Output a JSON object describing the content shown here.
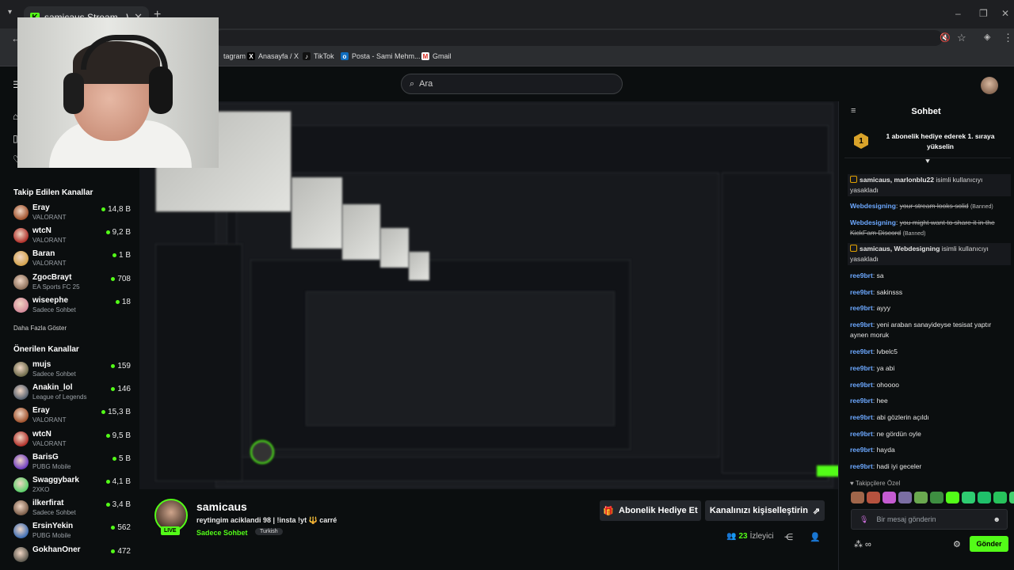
{
  "browser": {
    "tab_title": "samicaus Stream - Watch L",
    "bookmarks": [
      "tagram",
      "Anasayfa / X",
      "TikTok",
      "Posta - Sami Mehm...",
      "Gmail"
    ]
  },
  "kick": {
    "search_placeholder": "Ara"
  },
  "sidebar": {
    "followed_title": "Takip Edilen Kanallar",
    "followed": [
      {
        "name": "Eray",
        "game": "VALORANT",
        "viewers": "14,8 B",
        "color": "#a0522d"
      },
      {
        "name": "wtcN",
        "game": "VALORANT",
        "viewers": "9,2 B",
        "color": "#b0302a"
      },
      {
        "name": "Baran",
        "game": "VALORANT",
        "viewers": "1 B",
        "color": "#d2a24c"
      },
      {
        "name": "ZgocBrayt",
        "game": "EA Sports FC 25",
        "viewers": "708",
        "color": "#8c6f5a"
      },
      {
        "name": "wiseephe",
        "game": "Sadece Sohbet",
        "viewers": "18",
        "color": "#d48a9a"
      }
    ],
    "show_more": "Daha Fazla Göster",
    "recommended_title": "Önerilen Kanallar",
    "recommended": [
      {
        "name": "mujs",
        "game": "Sadece Sohbet",
        "viewers": "159",
        "color": "#6d6a4a"
      },
      {
        "name": "Anakin_lol",
        "game": "League of Legends",
        "viewers": "146",
        "color": "#56606e"
      },
      {
        "name": "Eray",
        "game": "VALORANT",
        "viewers": "15,3 B",
        "color": "#a0522d"
      },
      {
        "name": "wtcN",
        "game": "VALORANT",
        "viewers": "9,5 B",
        "color": "#b0302a"
      },
      {
        "name": "BarisG",
        "game": "PUBG Mobile",
        "viewers": "5 B",
        "color": "#6f3dc0"
      },
      {
        "name": "Swaggybark",
        "game": "2XKO",
        "viewers": "4,1 B",
        "color": "#5bd06a"
      },
      {
        "name": "ilkerfirat",
        "game": "Sadece Sohbet",
        "viewers": "3,4 B",
        "color": "#7a5c48"
      },
      {
        "name": "ErsinYekin",
        "game": "PUBG Mobile",
        "viewers": "562",
        "color": "#3d6db3"
      },
      {
        "name": "GokhanOner",
        "game": "",
        "viewers": "472",
        "color": "#5e5a50"
      }
    ]
  },
  "stream": {
    "channel": "samicaus",
    "title": "reytingim aciklandi 98 | !insta !yt 🔱 carré",
    "category": "Sadece Sohbet",
    "tag": "Turkish",
    "live_label": "LIVE",
    "gift_button": "Abonelik Hediye Et",
    "customize_button": "Kanalınızı kişiselleştirin",
    "viewer_count": "23",
    "viewer_label": "İzleyici"
  },
  "chat": {
    "title": "Sohbet",
    "pinned_rank": "1",
    "pinned_text": "1 abonelik hediye ederek 1. sıraya yükselin",
    "messages": [
      {
        "type": "sys",
        "user": "samicaus, marlonblu22",
        "text": " isimli kullanıcıyı yasakladı"
      },
      {
        "type": "ban",
        "user": "Webdesigning",
        "text": "your stream looks solid",
        "tag": "(Banned)"
      },
      {
        "type": "ban",
        "user": "Webdesigning",
        "text": "you might want to share it in the KickFam Discord",
        "tag": "(Banned)"
      },
      {
        "type": "sys",
        "user": "samicaus, Webdesigning",
        "text": " isimli kullanıcıyı yasakladı"
      },
      {
        "type": "msg",
        "user": "ree9brt",
        "text": "sa"
      },
      {
        "type": "msg",
        "user": "ree9brt",
        "text": "sakinsss"
      },
      {
        "type": "msg",
        "user": "ree9brt",
        "text": "ayyy"
      },
      {
        "type": "msg",
        "user": "ree9brt",
        "text": "yeni araban sanayideyse tesisat yaptır aynen moruk"
      },
      {
        "type": "msg",
        "user": "ree9brt",
        "text": "lvbelc5"
      },
      {
        "type": "msg",
        "user": "ree9brt",
        "text": "ya abi"
      },
      {
        "type": "msg",
        "user": "ree9brt",
        "text": "ohoooo"
      },
      {
        "type": "msg",
        "user": "ree9brt",
        "text": "hee"
      },
      {
        "type": "msg",
        "user": "ree9brt",
        "text": "abi gözlerin açıldı"
      },
      {
        "type": "msg",
        "user": "ree9brt",
        "text": "ne gördün oyle"
      },
      {
        "type": "msg",
        "user": "ree9brt",
        "text": "hayda"
      },
      {
        "type": "msg",
        "user": "ree9brt",
        "text": "hadi iyi geceler"
      }
    ],
    "followers_only": "Takipçilere Özel",
    "input_placeholder": "Bir mesaj gönderin",
    "send_button": "Gönder"
  },
  "colors": {
    "accent": "#53fc18",
    "username": "#6ca8ff",
    "background": "#0b0e0f"
  }
}
